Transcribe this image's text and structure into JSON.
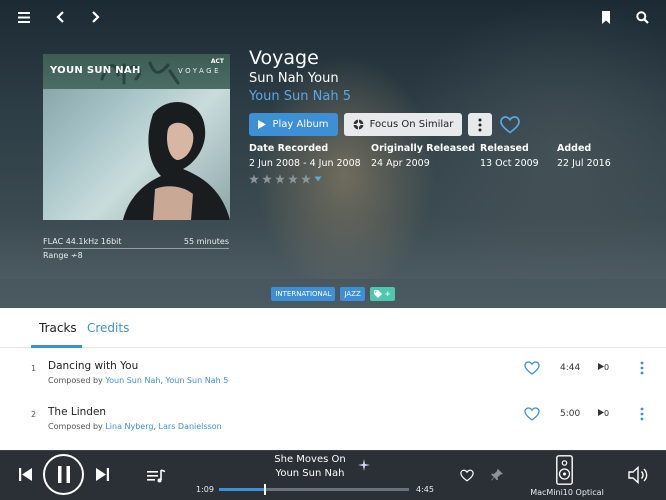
{
  "topbar": {
    "icons": [
      "menu-icon",
      "back-icon",
      "forward-icon",
      "bookmark-icon",
      "search-icon"
    ]
  },
  "album": {
    "cover_artist": "YOUN SUN NAH",
    "cover_title": "VOYAGE",
    "cover_label": "ACT",
    "format": "FLAC 44.1kHz 16bit",
    "duration": "55 minutes",
    "range": "Range ≁8",
    "title": "Voyage",
    "artist": "Sun Nah Youn",
    "album_artist_link": "Youn Sun Nah 5",
    "play_button": "Play Album",
    "focus_button": "Focus On Similar",
    "dates": [
      {
        "heading": "Date Recorded",
        "value": "2 Jun 2008 - 4 Jun 2008"
      },
      {
        "heading": "Originally Released",
        "value": "24 Apr 2009"
      },
      {
        "heading": "Released",
        "value": "13 Oct 2009"
      },
      {
        "heading": "Added",
        "value": "22 Jul 2016"
      }
    ],
    "rating": 0
  },
  "genres": [
    "INTERNATIONAL",
    "JAZZ"
  ],
  "tag_add": "+",
  "tabs": {
    "tracks": "Tracks",
    "credits": "Credits"
  },
  "tracks": [
    {
      "num": "1",
      "title": "Dancing with You",
      "composed_prefix": "Composed by ",
      "composers": [
        "Youn Sun Nah",
        "Youn Sun Nah 5"
      ],
      "duration": "4:44",
      "plays": "0"
    },
    {
      "num": "2",
      "title": "The Linden",
      "composed_prefix": "Composed by ",
      "composers": [
        "Lina Nyberg",
        "Lars Danielsson"
      ],
      "duration": "5:00",
      "plays": "0"
    }
  ],
  "player": {
    "now_title": "She Moves On",
    "now_artist": "Youn Sun Nah",
    "elapsed": "1:09",
    "total": "4:45",
    "progress": 0.242,
    "zone": "MacMini10 Optical"
  },
  "colors": {
    "accent": "#3d8fd6",
    "link": "#5fa6e6",
    "tag": "#4fc7b0",
    "player_bg": "#2a3036"
  }
}
